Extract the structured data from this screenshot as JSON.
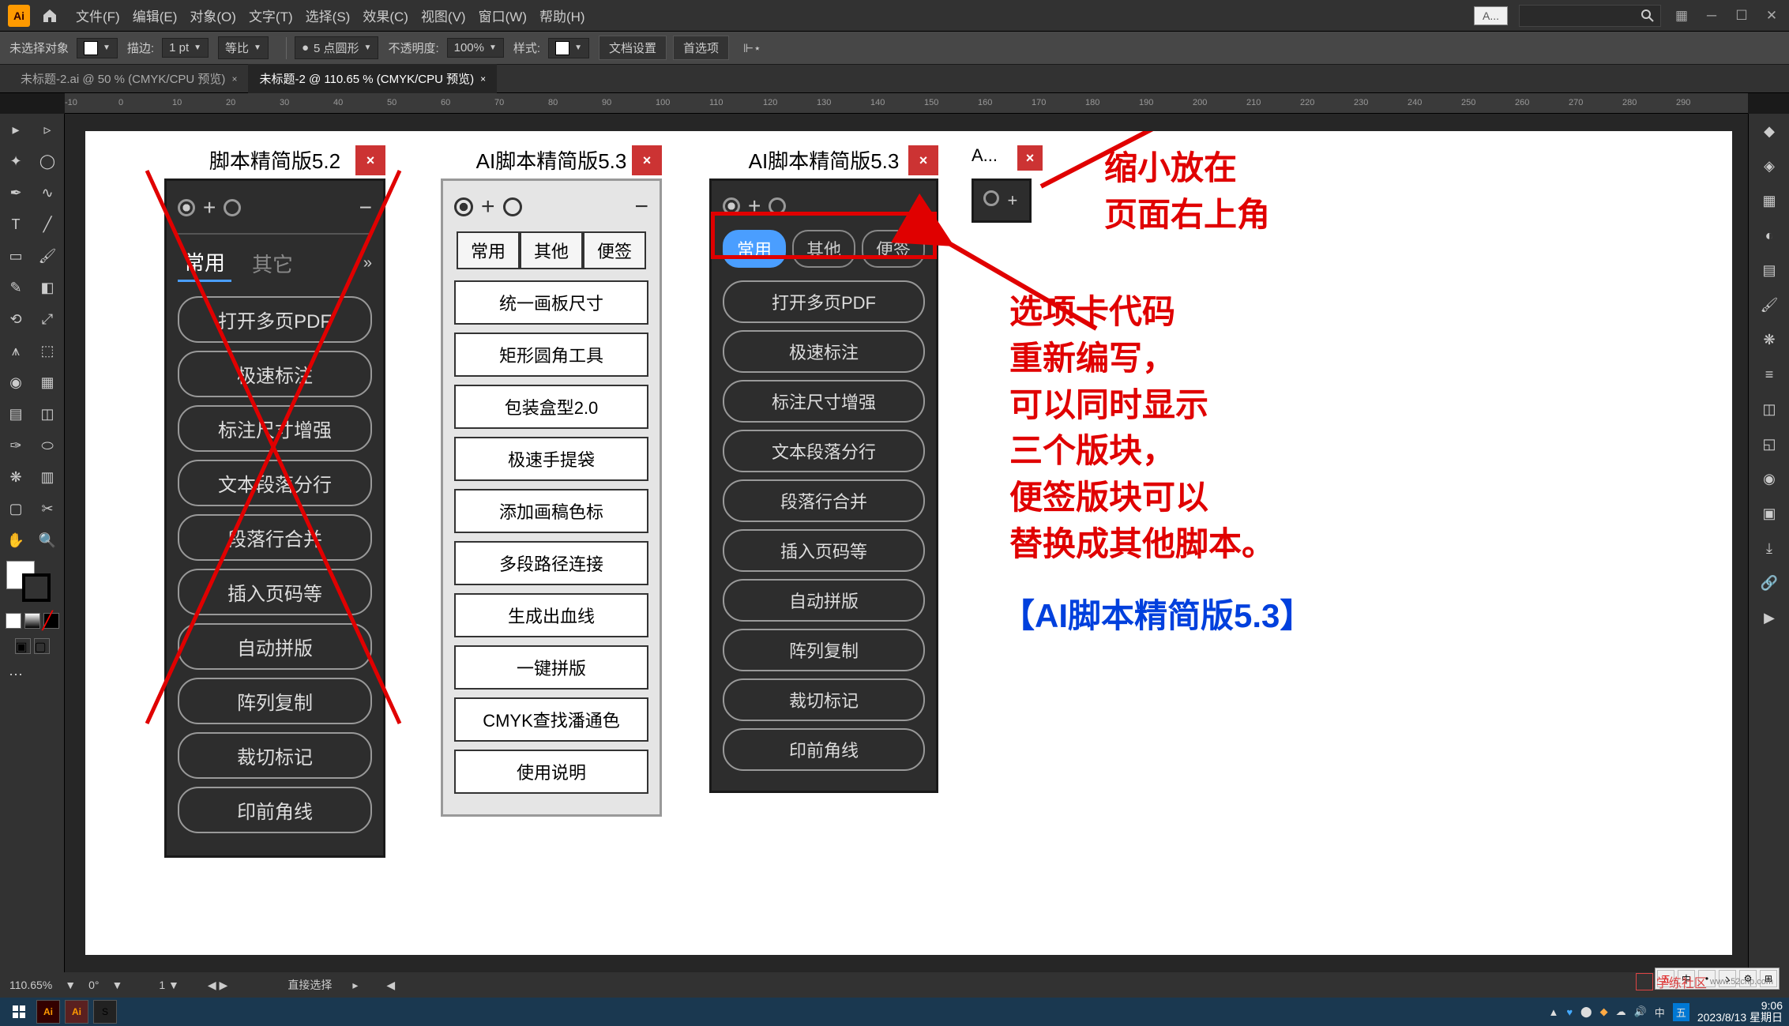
{
  "menubar": {
    "items": [
      "文件(F)",
      "编辑(E)",
      "对象(O)",
      "文字(T)",
      "选择(S)",
      "效果(C)",
      "视图(V)",
      "窗口(W)",
      "帮助(H)"
    ]
  },
  "search_placeholder": "A...",
  "control": {
    "no_sel": "未选择对象",
    "stroke": "描边:",
    "stroke_val": "1 pt",
    "uniform": "等比",
    "pt5": "5 点圆形",
    "opacity": "不透明度:",
    "opacity_val": "100%",
    "style": "样式:",
    "doc_setup": "文档设置",
    "prefs": "首选项"
  },
  "tabs": [
    {
      "label": "未标题-2.ai @ 50 % (CMYK/CPU 预览)"
    },
    {
      "label": "未标题-2 @ 110.65 % (CMYK/CPU 预览)"
    }
  ],
  "panel1": {
    "title": "脚本精简版5.2",
    "tabs": {
      "a": "常用",
      "b": "其它"
    },
    "buttons": [
      "打开多页PDF",
      "极速标注",
      "标注尺寸增强",
      "文本段落分行",
      "段落行合并",
      "插入页码等",
      "自动拼版",
      "阵列复制",
      "裁切标记",
      "印前角线"
    ]
  },
  "panel2": {
    "title": "AI脚本精简版5.3",
    "tabs": {
      "a": "常用",
      "b": "其他",
      "c": "便签"
    },
    "buttons": [
      "统一画板尺寸",
      "矩形圆角工具",
      "包装盒型2.0",
      "极速手提袋",
      "添加画稿色标",
      "多段路径连接",
      "生成出血线",
      "一键拼版",
      "CMYK查找潘通色",
      "使用说明"
    ]
  },
  "panel3": {
    "title": "AI脚本精简版5.3",
    "tabs": {
      "a": "常用",
      "b": "其他",
      "c": "便签"
    },
    "buttons": [
      "打开多页PDF",
      "极速标注",
      "标注尺寸增强",
      "文本段落分行",
      "段落行合并",
      "插入页码等",
      "自动拼版",
      "阵列复制",
      "裁切标记",
      "印前角线"
    ]
  },
  "mini": {
    "title": "A..."
  },
  "anno1": {
    "l1": "缩小放在",
    "l2": "页面右上角"
  },
  "anno2": {
    "l1": "选项卡代码",
    "l2": "重新编写，",
    "l3": "可以同时显示",
    "l4": "三个版块，",
    "l5": "便签版块可以",
    "l6": "替换成其他脚本。"
  },
  "anno_blue": "【AI脚本精简版5.3】",
  "status": {
    "zoom": "110.65%",
    "angle": "0°",
    "tool": "直接选择"
  },
  "clock": {
    "time": "9:06",
    "date": "2023/8/13 星期日"
  },
  "ruler_marks": [
    "-10",
    "0",
    "10",
    "20",
    "30",
    "40",
    "50",
    "60",
    "70",
    "80",
    "90",
    "100",
    "110",
    "120",
    "130",
    "140",
    "150",
    "160",
    "170",
    "180",
    "190",
    "200",
    "210",
    "220",
    "230",
    "240",
    "250",
    "260",
    "270",
    "280",
    "290"
  ]
}
